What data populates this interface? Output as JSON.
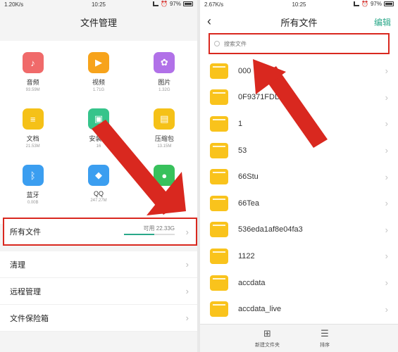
{
  "left": {
    "status": {
      "net": "1.20K/s",
      "time": "10:25",
      "battery": "97%"
    },
    "title": "文件管理",
    "categories": [
      {
        "name": "音频",
        "size": "93.59M",
        "icon": "music-note-icon",
        "color": "#f06a6a"
      },
      {
        "name": "视频",
        "size": "1.71G",
        "icon": "play-icon",
        "color": "#f7a31b"
      },
      {
        "name": "图片",
        "size": "1.32G",
        "icon": "flower-icon",
        "color": "#b171e8"
      },
      {
        "name": "文档",
        "size": "21.53M",
        "icon": "document-icon",
        "color": "#f5c118"
      },
      {
        "name": "安装包",
        "size": "16",
        "icon": "android-icon",
        "color": "#36c48b"
      },
      {
        "name": "压缩包",
        "size": "13.15M",
        "icon": "archive-icon",
        "color": "#f5c118"
      },
      {
        "name": "蓝牙",
        "size": "0.00B",
        "icon": "bluetooth-icon",
        "color": "#3b9ef0"
      },
      {
        "name": "QQ",
        "size": "247.27M",
        "icon": "qq-icon",
        "color": "#3b9ef0"
      },
      {
        "name": "微信",
        "size": "69.46M",
        "icon": "wechat-icon",
        "color": "#38c15c"
      }
    ],
    "all_files": {
      "label": "所有文件",
      "free": "可用 22.33G",
      "used_fraction": 0.6
    },
    "menu": [
      {
        "label": "清理"
      },
      {
        "label": "远程管理"
      },
      {
        "label": "文件保险箱"
      }
    ]
  },
  "right": {
    "status": {
      "net": "2.67K/s",
      "time": "10:25",
      "battery": "97%"
    },
    "title": "所有文件",
    "edit_label": "编辑",
    "search_placeholder": "搜索文件",
    "files": [
      {
        "name": "000"
      },
      {
        "name": "0F9371FDD"
      },
      {
        "name": "1"
      },
      {
        "name": "53"
      },
      {
        "name": "66Stu"
      },
      {
        "name": "66Tea"
      },
      {
        "name": "536eda1af8e04fa3"
      },
      {
        "name": "1122"
      },
      {
        "name": "accdata"
      },
      {
        "name": "accdata_live"
      }
    ],
    "bottom": {
      "new_folder": "新建文件夹",
      "sort": "排序"
    }
  },
  "colors": {
    "accent": "#2aa889",
    "highlight_red": "#d9281f",
    "folder": "#f9c31c"
  }
}
